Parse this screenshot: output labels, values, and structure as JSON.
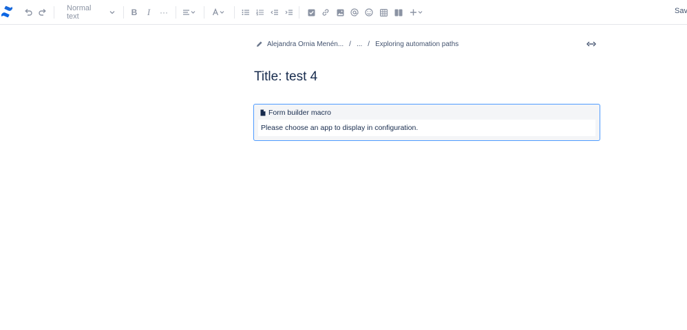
{
  "toolbar": {
    "text_style": "Normal text",
    "more_label": "···",
    "save_label": "Save"
  },
  "breadcrumb": {
    "author": "Alejandra Ornia Menén...",
    "ellipsis": "...",
    "page": "Exploring automation paths"
  },
  "page": {
    "title": "Title: test 4"
  },
  "macro": {
    "name": "Form builder macro",
    "message": "Please choose an app to display in configuration."
  },
  "colors": {
    "brand": "#0052cc",
    "macro_border": "#4c9aff",
    "toolbar_icon": "#8b93a3",
    "text": "#172b4d"
  }
}
